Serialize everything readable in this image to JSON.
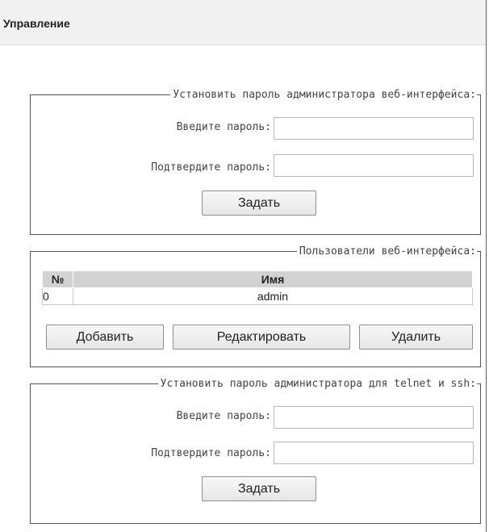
{
  "header": {
    "title": "Управление"
  },
  "web_password": {
    "legend": "Установить пароль администратора веб-интерфейса:",
    "password_label": "Введите пароль:",
    "password_value": "",
    "confirm_label": "Подтвердите пароль:",
    "confirm_value": "",
    "submit_label": "Задать"
  },
  "web_users": {
    "legend": "Пользователи веб-интерфейса:",
    "columns": [
      "№",
      "Имя"
    ],
    "rows": [
      {
        "num": "0",
        "name": "admin"
      }
    ],
    "add_label": "Добавить",
    "edit_label": "Редактировать",
    "delete_label": "Удалить"
  },
  "telnet_password": {
    "legend": "Установить пароль администратора для telnet и ssh:",
    "password_label": "Введите пароль:",
    "password_value": "",
    "confirm_label": "Подтвердите пароль:",
    "confirm_value": "",
    "submit_label": "Задать"
  }
}
